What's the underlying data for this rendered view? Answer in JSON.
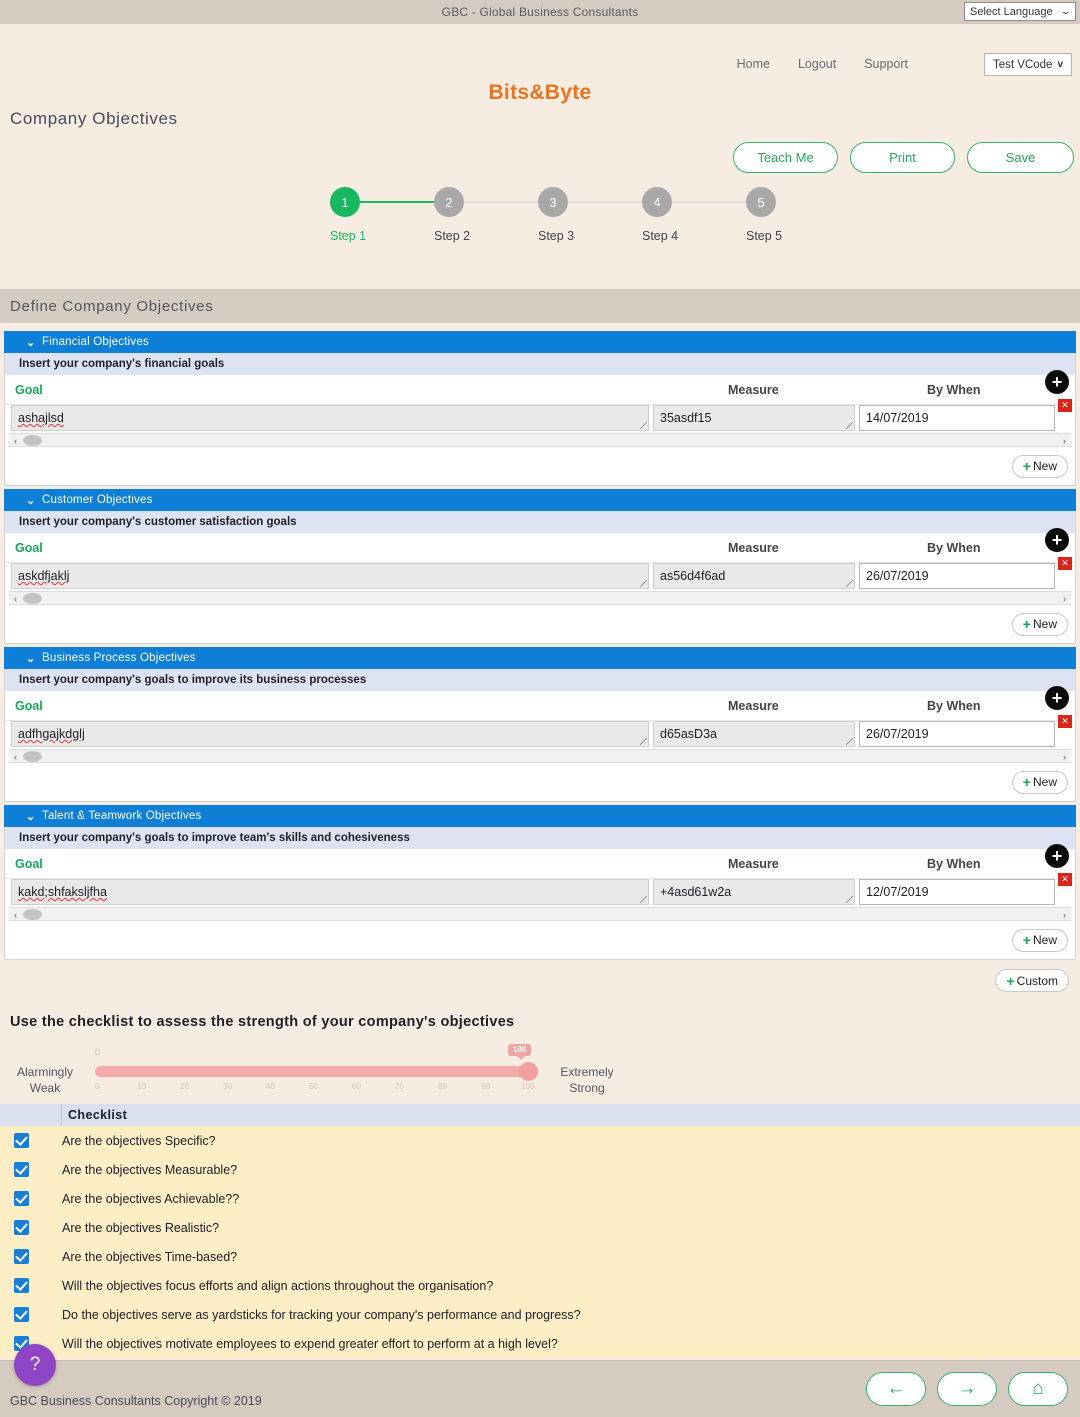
{
  "topbar": {
    "title": "GBC - Global Business Consultants",
    "language_select": {
      "label": "Select Language",
      "chevron": "chevron-down-icon"
    }
  },
  "header": {
    "nav": [
      {
        "label": "Home"
      },
      {
        "label": "Logout"
      },
      {
        "label": "Support"
      }
    ],
    "vcode": {
      "label": "Test VCode",
      "chevron": "v"
    },
    "brand": "Bits&Byte",
    "page_title": "Company Objectives"
  },
  "actions": {
    "teach_me": "Teach Me",
    "print": "Print",
    "save": "Save"
  },
  "stepper": {
    "current": 1,
    "steps": [
      {
        "number": "1",
        "label": "Step 1"
      },
      {
        "number": "2",
        "label": "Step 2"
      },
      {
        "number": "3",
        "label": "Step 3"
      },
      {
        "number": "4",
        "label": "Step 4"
      },
      {
        "number": "5",
        "label": "Step 5"
      }
    ]
  },
  "section_banner": "Define Company Objectives",
  "columns": {
    "goal": "Goal",
    "measure": "Measure",
    "by_when": "By When"
  },
  "buttons": {
    "new": "New",
    "custom": "Custom",
    "plus": "+"
  },
  "panels": [
    {
      "title": "Financial Objectives",
      "subtitle": "Insert your company's financial goals",
      "row": {
        "goal": "ashajlsd",
        "measure": "35asdf15",
        "by_when": "14/07/2019"
      }
    },
    {
      "title": "Customer Objectives",
      "subtitle": "Insert your company's customer satisfaction goals",
      "row": {
        "goal": "askdfjaklj",
        "measure": "as56d4f6ad",
        "by_when": "26/07/2019"
      }
    },
    {
      "title": "Business Process Objectives",
      "subtitle": "Insert your company's goals to improve its business processes",
      "row": {
        "goal": "adfhgajkdglj",
        "measure": "d65asD3a",
        "by_when": "26/07/2019"
      }
    },
    {
      "title": "Talent & Teamwork Objectives",
      "subtitle": "Insert your company's goals to improve team's skills and cohesiveness",
      "row": {
        "goal": "kakd;shfaksljfha",
        "measure": "+4asd61w2a",
        "by_when": "12/07/2019"
      }
    }
  ],
  "assessment": {
    "title": "Use the checklist to assess the strength of your company's objectives",
    "slider": {
      "left_label": "Alarmingly\nWeak",
      "left_label_line1": "Alarmingly",
      "left_label_line2": "Weak",
      "right_label_line1": "Extremely",
      "right_label_line2": "Strong",
      "min": 0,
      "max": 100,
      "value": 100,
      "value_badge": "100",
      "zero_marker": "0",
      "ticks": [
        "0",
        "10",
        "20",
        "30",
        "40",
        "50",
        "60",
        "70",
        "80",
        "90",
        "100"
      ],
      "track_color": "#f2aaaa",
      "badge_color": "#efa3a3"
    },
    "checklist_header": "Checklist",
    "checklist": [
      {
        "checked": true,
        "text": "Are the objectives Specific?"
      },
      {
        "checked": true,
        "text": "Are the objectives Measurable?"
      },
      {
        "checked": true,
        "text": "Are the objectives Achievable??"
      },
      {
        "checked": true,
        "text": "Are the objectives Realistic?"
      },
      {
        "checked": true,
        "text": "Are the objectives Time-based?"
      },
      {
        "checked": true,
        "text": "Will the objectives focus efforts and align actions throughout the organisation?"
      },
      {
        "checked": true,
        "text": "Do the objectives serve as yardsticks for tracking your company's performance and progress?"
      },
      {
        "checked": true,
        "text": "Will the objectives motivate employees to expend greater effort to perform at a high level?"
      }
    ]
  },
  "footer": {
    "copyright": "GBC Business Consultants Copyright © 2019",
    "help": "?",
    "nav": [
      {
        "icon": "arrow-left-icon",
        "glyph": "←"
      },
      {
        "icon": "arrow-right-icon",
        "glyph": "→"
      },
      {
        "icon": "home-icon",
        "glyph": "⌂"
      }
    ]
  },
  "colors": {
    "accent_blue": "#0d7fd6",
    "accent_green": "#17b85f",
    "brand_orange": "#e8741e",
    "page_bg": "#f7ece2",
    "bar_bg": "#d6cbc1",
    "checklist_bg": "#fdeec6",
    "help_purple": "#8e44c4"
  }
}
